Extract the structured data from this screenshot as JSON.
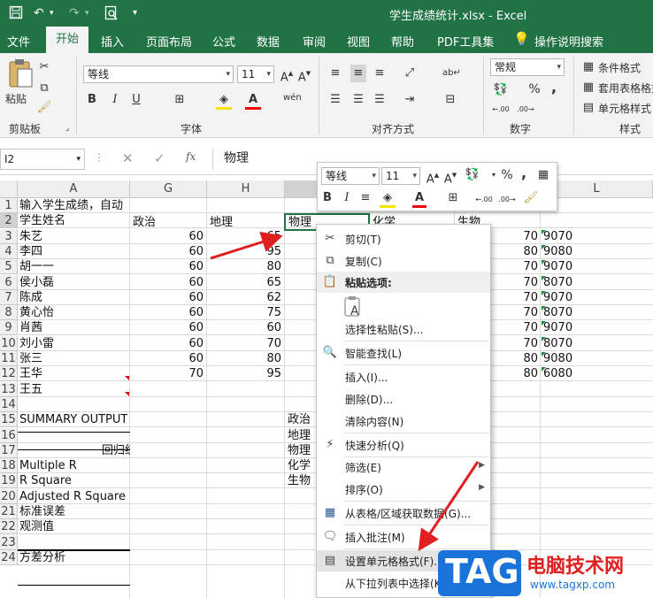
{
  "titlebar": {
    "title": "学生成绩统计.xlsx  -  Excel",
    "save_icon": "save-icon",
    "undo_icon": "undo-icon",
    "redo_icon": "redo-icon",
    "preview_icon": "print-preview-icon",
    "customize": "▾"
  },
  "tabs": [
    "文件",
    "开始",
    "插入",
    "页面布局",
    "公式",
    "数据",
    "审阅",
    "视图",
    "帮助",
    "PDF工具集"
  ],
  "tell_me": "操作说明搜索",
  "ribbon": {
    "clipboard": {
      "label": "剪贴板",
      "paste": "粘贴"
    },
    "font": {
      "label": "字体",
      "name": "等线",
      "size": "11",
      "bold": "B",
      "italic": "I",
      "underline": "U",
      "wen": "wén"
    },
    "align": {
      "label": "对齐方式"
    },
    "number": {
      "label": "数字",
      "format": "常规",
      "percent": "%",
      "comma": ","
    },
    "styles": {
      "label": "样式",
      "cond": "条件格式",
      "table": "套用表格格式",
      "cell": "单元格样式"
    }
  },
  "formula": {
    "namebox": "I2",
    "fx": "fx",
    "value": "物理"
  },
  "columns": [
    "A",
    "G",
    "H",
    "",
    "",
    "",
    "L"
  ],
  "rows": [
    "1",
    "2",
    "3",
    "4",
    "5",
    "6",
    "7",
    "8",
    "9",
    "10",
    "11",
    "12",
    "13",
    "14",
    "15",
    "16",
    "17",
    "18",
    "19",
    "20",
    "21",
    "22",
    "23",
    "24"
  ],
  "colA": [
    "输入学生成绩，自动",
    "学生姓名",
    "朱艺",
    "李四",
    "胡一一",
    "侯小磊",
    "陈成",
    "黄心怡",
    "肖茜",
    "刘小雷",
    "张三",
    "王华",
    "王五",
    "",
    "SUMMARY OUTPUT",
    "",
    "回归统",
    "Multiple R",
    "R Square",
    "Adjusted R Square",
    "标准误差",
    "观测值",
    "",
    "方差分析"
  ],
  "colG_header": "政治",
  "colG": [
    "60",
    "60",
    "60",
    "60",
    "60",
    "60",
    "60",
    "60",
    "60",
    "70"
  ],
  "colH_header": "地理",
  "colH": [
    "65",
    "95",
    "80",
    "65",
    "62",
    "75",
    "60",
    "70",
    "80",
    "95"
  ],
  "colI_header": "物理",
  "colJ_header": "化学",
  "colK_header": "生物",
  "colK": [
    "70",
    "80",
    "70",
    "70",
    "70",
    "70",
    "70",
    "70",
    "80",
    "80"
  ],
  "colL": [
    "9070",
    "9080",
    "9070",
    "8070",
    "9070",
    "8070",
    "9070",
    "8070",
    "9080",
    "6080"
  ],
  "colI_lower": [
    "政治",
    "地理",
    "物理",
    "化学",
    "生物"
  ],
  "minitoolbar": {
    "font": "等线",
    "size": "11",
    "bold": "B",
    "italic": "I",
    "percent": "%",
    "comma": ","
  },
  "menu": [
    {
      "label": "剪切(T)",
      "icon": "scissors-icon"
    },
    {
      "label": "复制(C)",
      "icon": "copy-icon"
    },
    {
      "label": "粘贴选项:",
      "icon": "paste-icon"
    },
    {
      "label": "选择性粘贴(S)...",
      "icon": ""
    },
    {
      "label": "智能查找(L)",
      "icon": "smart-lookup-icon"
    },
    {
      "label": "插入(I)...",
      "icon": ""
    },
    {
      "label": "删除(D)...",
      "icon": ""
    },
    {
      "label": "清除内容(N)",
      "icon": ""
    },
    {
      "label": "快速分析(Q)",
      "icon": "quick-analysis-icon"
    },
    {
      "label": "筛选(E)",
      "icon": ""
    },
    {
      "label": "排序(O)",
      "icon": ""
    },
    {
      "label": "从表格/区域获取数据(G)...",
      "icon": "table-icon"
    },
    {
      "label": "插入批注(M)",
      "icon": "comment-icon"
    },
    {
      "label": "设置单元格格式(F)...",
      "icon": "format-cells-icon"
    },
    {
      "label": "从下拉列表中选择(K)...",
      "icon": ""
    }
  ],
  "watermark": {
    "tag": "TAG",
    "site": "电脑技术网",
    "url": "www.tagxp.com"
  },
  "colors": {
    "excel_green": "#217346",
    "arrow_red": "#e02020",
    "tag_blue": "#1a73d9"
  }
}
